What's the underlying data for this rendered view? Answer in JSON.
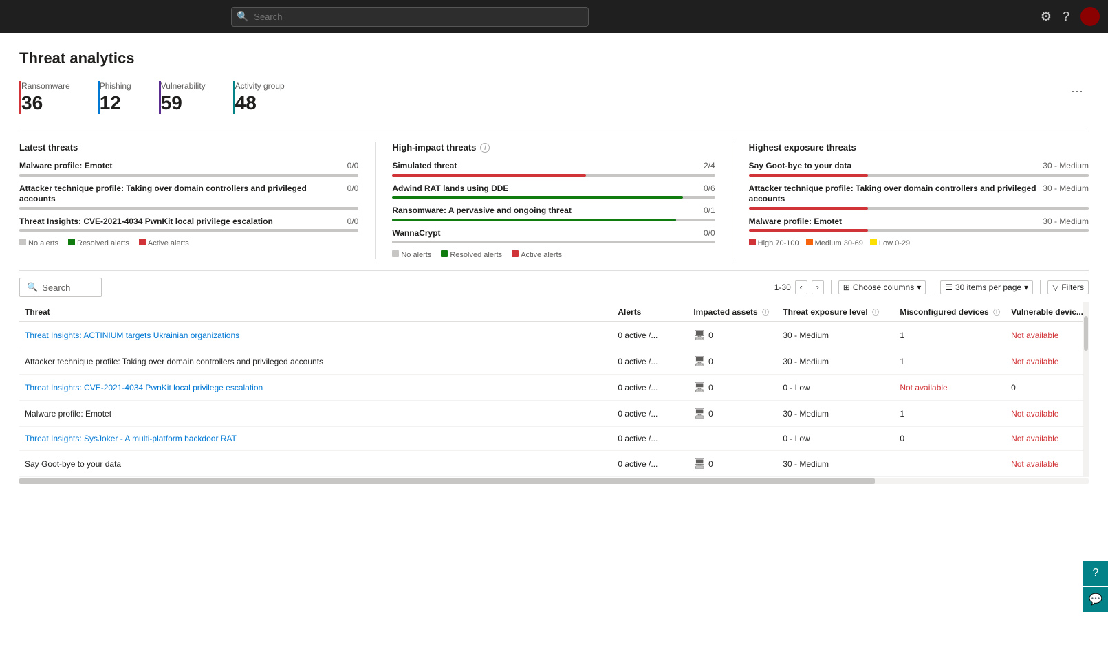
{
  "topbar": {
    "search_placeholder": "Search",
    "settings_icon": "⚙",
    "help_icon": "?",
    "avatar_initial": ""
  },
  "page": {
    "title": "Threat analytics"
  },
  "stats": [
    {
      "label": "Ransomware",
      "value": "36",
      "color": "red"
    },
    {
      "label": "Phishing",
      "value": "12",
      "color": "blue"
    },
    {
      "label": "Vulnerability",
      "value": "59",
      "color": "purple"
    },
    {
      "label": "Activity group",
      "value": "48",
      "color": "teal"
    }
  ],
  "panels": {
    "latest": {
      "title": "Latest threats",
      "items": [
        {
          "name": "Malware profile: Emotet",
          "score": "0/0",
          "green_pct": 0,
          "red_pct": 0
        },
        {
          "name": "Attacker technique profile: Taking over domain controllers and privileged accounts",
          "score": "0/0",
          "green_pct": 0,
          "red_pct": 0
        },
        {
          "name": "Threat Insights: CVE-2021-4034 PwnKit local privilege escalation",
          "score": "0/0",
          "green_pct": 0,
          "red_pct": 0
        }
      ],
      "legend": [
        {
          "color": "#c8c6c4",
          "label": "No alerts"
        },
        {
          "color": "#107c10",
          "label": "Resolved alerts"
        },
        {
          "color": "#d13438",
          "label": "Active alerts"
        }
      ]
    },
    "high_impact": {
      "title": "High-impact threats",
      "has_info": true,
      "items": [
        {
          "name": "Simulated threat",
          "score": "2/4",
          "green_pct": 60,
          "red_pct": 0
        },
        {
          "name": "Adwind RAT lands using DDE",
          "score": "0/6",
          "green_pct": 90,
          "red_pct": 0
        },
        {
          "name": "Ransomware: A pervasive and ongoing threat",
          "score": "0/1",
          "green_pct": 88,
          "red_pct": 0
        },
        {
          "name": "WannaCrypt",
          "score": "0/0",
          "green_pct": 0,
          "red_pct": 0
        }
      ],
      "legend": [
        {
          "color": "#c8c6c4",
          "label": "No alerts"
        },
        {
          "color": "#107c10",
          "label": "Resolved alerts"
        },
        {
          "color": "#d13438",
          "label": "Active alerts"
        }
      ]
    },
    "highest_exposure": {
      "title": "Highest exposure threats",
      "items": [
        {
          "name": "Say Goot-bye to your data",
          "score": "30 - Medium",
          "red_pct": 35
        },
        {
          "name": "Attacker technique profile: Taking over domain controllers and privileged accounts",
          "score": "30 - Medium",
          "red_pct": 35
        },
        {
          "name": "Malware profile: Emotet",
          "score": "30 - Medium",
          "red_pct": 35
        }
      ],
      "legend": [
        {
          "color": "#d13438",
          "label": "High 70-100"
        },
        {
          "color": "#f7630c",
          "label": "Medium 30-69"
        },
        {
          "color": "#fce100",
          "label": "Low 0-29"
        }
      ]
    }
  },
  "table": {
    "search_placeholder": "Search",
    "pagination": "1-30",
    "per_page": "30 items per page",
    "choose_columns": "Choose columns",
    "filters": "Filters",
    "columns": [
      {
        "id": "threat",
        "label": "Threat"
      },
      {
        "id": "alerts",
        "label": "Alerts"
      },
      {
        "id": "impacted",
        "label": "Impacted assets"
      },
      {
        "id": "exposure",
        "label": "Threat exposure level"
      },
      {
        "id": "misconfigured",
        "label": "Misconfigured devices"
      },
      {
        "id": "vulnerable",
        "label": "Vulnerable devic..."
      }
    ],
    "rows": [
      {
        "threat": "Threat Insights: ACTINIUM targets Ukrainian organizations",
        "is_link": true,
        "alerts": "0 active /...",
        "impacted": "0",
        "exposure": "30 - Medium",
        "misconfigured": "1",
        "vulnerable": "Not available"
      },
      {
        "threat": "Attacker technique profile: Taking over domain controllers and privileged accounts",
        "is_link": false,
        "alerts": "0 active /...",
        "impacted": "0",
        "exposure": "30 - Medium",
        "misconfigured": "1",
        "vulnerable": "Not available"
      },
      {
        "threat": "Threat Insights: CVE-2021-4034 PwnKit local privilege escalation",
        "is_link": true,
        "alerts": "0 active /...",
        "impacted": "0",
        "exposure": "0 - Low",
        "misconfigured": "Not available",
        "vulnerable": "0"
      },
      {
        "threat": "Malware profile: Emotet",
        "is_link": false,
        "alerts": "0 active /...",
        "impacted": "0",
        "exposure": "30 - Medium",
        "misconfigured": "1",
        "vulnerable": "Not available"
      },
      {
        "threat": "Threat Insights: SysJoker - A multi-platform backdoor RAT",
        "is_link": true,
        "alerts": "0 active /...",
        "impacted": "",
        "exposure": "0 - Low",
        "misconfigured": "0",
        "vulnerable": "Not available"
      },
      {
        "threat": "Say Goot-bye to your data",
        "is_link": false,
        "alerts": "0 active /...",
        "impacted": "0",
        "exposure": "30 - Medium",
        "misconfigured": "",
        "vulnerable": "Not available"
      }
    ]
  },
  "side_actions": [
    {
      "icon": "💬",
      "name": "feedback"
    },
    {
      "icon": "📊",
      "name": "chart"
    }
  ]
}
